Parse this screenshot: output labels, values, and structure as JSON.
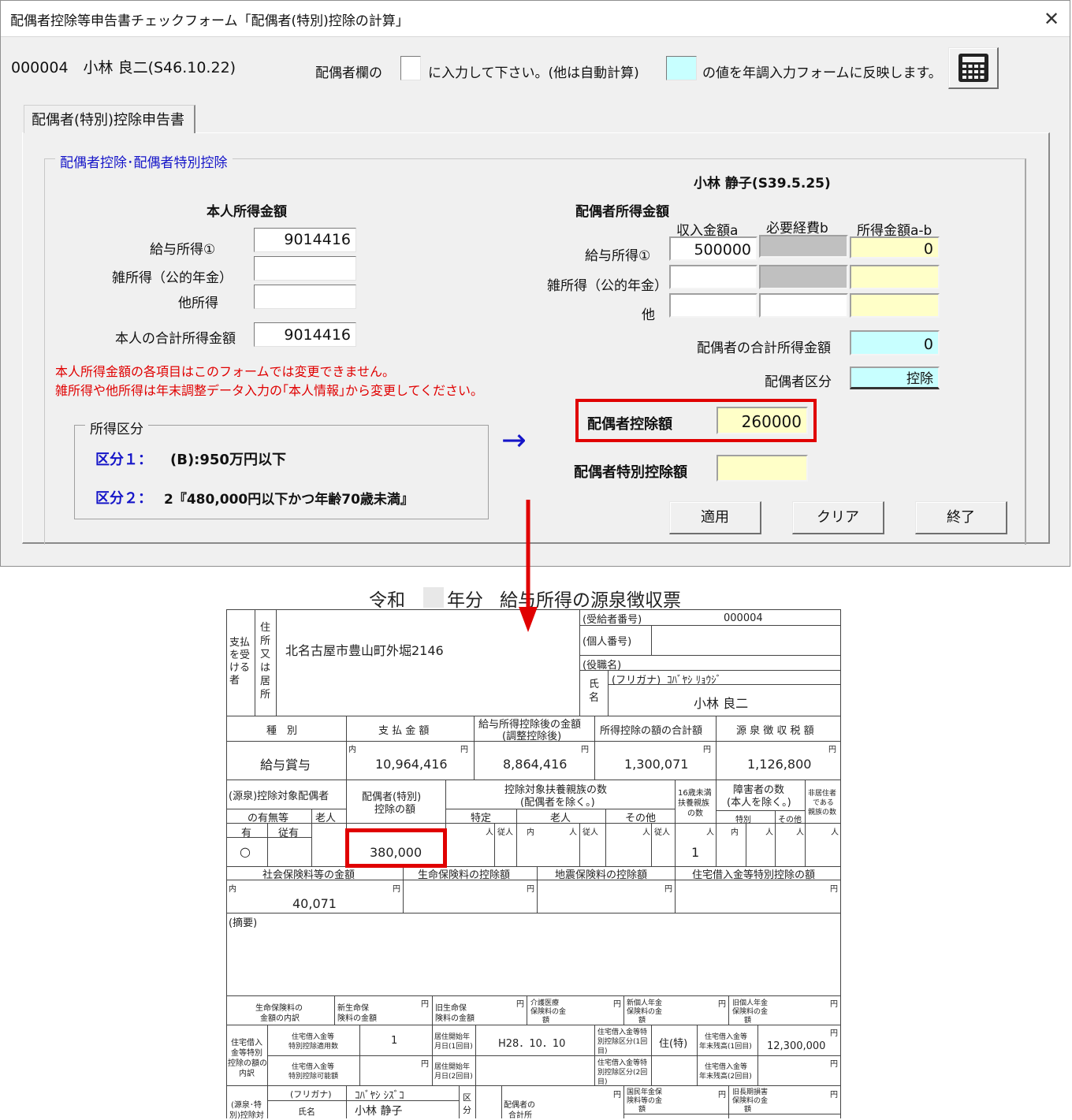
{
  "window": {
    "title": "配偶者控除等申告書チェックフォーム「配偶者(特別)控除の計算」",
    "close_label": "✕"
  },
  "header": {
    "employee": "000004　小林 良二(S46.10.22)",
    "instruction_prefix": "配偶者欄の",
    "instruction_middle": "に入力して下さい。(他は自動計算)",
    "instruction_suffix": "の値を年調入力フォームに反映します。"
  },
  "tab": {
    "label": "配偶者(特別)控除申告書"
  },
  "group": {
    "label": "配偶者控除･配偶者特別控除"
  },
  "self_income": {
    "heading": "本人所得金額",
    "salary_label": "給与所得①",
    "salary_value": "9014416",
    "misc_label": "雑所得（公的年金）",
    "misc_value": "",
    "other_label": "他所得",
    "other_value": "",
    "total_label": "本人の合計所得金額",
    "total_value": "9014416"
  },
  "notice": {
    "line1": "本人所得金額の各項目はこのフォームでは変更できません。",
    "line2": "雑所得や他所得は年末調整データ入力の｢本人情報｣から変更してください。"
  },
  "income_class": {
    "legend": "所得区分",
    "k1_label": "区分１：",
    "k1_value": "(B):950万円以下",
    "k2_label": "区分２：",
    "k2_value": "2『480,000円以下かつ年齢70歳未満』"
  },
  "spouse": {
    "name": "小林 静子(S39.5.25)",
    "heading": "配偶者所得金額",
    "col_a": "収入金額a",
    "col_b": "必要経費b",
    "col_ab": "所得金額a-b",
    "salary_label": "給与所得①",
    "salary_a": "500000",
    "salary_ab": "0",
    "misc_label": "雑所得（公的年金）",
    "other_label": "他",
    "total_label": "配偶者の合計所得金額",
    "total_value": "0",
    "class_label": "配偶者区分",
    "class_value": "控除",
    "deduction_label": "配偶者控除額",
    "deduction_value": "260000",
    "special_label": "配偶者特別控除額",
    "special_value": ""
  },
  "buttons": {
    "apply": "適用",
    "clear": "クリア",
    "end": "終了"
  },
  "arrow_right": "→",
  "colors": {
    "highlight_red": "#e00000",
    "input_yellow": "#ffffc8",
    "input_cyan": "#c8ffff",
    "label_blue": "#1515c8"
  },
  "icons": {
    "calculator": "calculator-icon"
  },
  "form": {
    "title_a": "令和",
    "title_b": "年分",
    "title_c": "給与所得の源泉徴収票",
    "recipient_side": "支払を受ける者",
    "address_label": "住所又は居所",
    "address": "北名古屋市豊山町外堀2146",
    "recipient_no_label": "(受給者番号)",
    "recipient_no": "000004",
    "personal_no_label": "(個人番号)",
    "position_label": "(役職名)",
    "name_label": "氏名",
    "furigana_label": "(フリガナ)",
    "furigana": "ｺﾊﾞﾔｼ ﾘｮｳｼﾞ",
    "name": "小林 良二",
    "h_type": "種　別",
    "h_paid": "支 払 金 額",
    "h_after1": "給与所得控除後の金額",
    "h_after2": "(調整控除後)",
    "h_deduct_total": "所得控除の額の合計額",
    "h_tax": "源 泉 徴 収 税 額",
    "type": "給与賞与",
    "paid": "10,964,416",
    "after": "8,864,416",
    "deduct_total": "1,300,071",
    "tax": "1,126,800",
    "unit_yen": "円",
    "unit_nin": "人",
    "unit_uchi": "内",
    "unit_ju": "従人",
    "spouse_exist1": "(源泉)控除対象配偶者",
    "spouse_exist2": "の有無等",
    "old": "老人",
    "spouse_ded1": "配偶者(特別)",
    "spouse_ded2": "控除の額",
    "dep1": "控除対象扶養親族の数",
    "dep2": "(配偶者を除く。)",
    "dep_special": "特定",
    "dep_old": "老人",
    "dep_other": "その他",
    "under16_1": "16歳未満",
    "under16_2": "扶養親族",
    "under16_3": "の数",
    "disabled1": "障害者の数",
    "disabled2": "(本人を除く。)",
    "disabled_special": "特別",
    "disabled_other": "その他",
    "nonres1": "非居住者",
    "nonres2": "である",
    "nonres3": "親族の数",
    "yes": "有",
    "dependent_yes": "従有",
    "mark": "○",
    "spouse_ded_value": "380,000",
    "under16_value": "1",
    "social_ins": "社会保険料等の金額",
    "life_ins": "生命保険料の控除額",
    "quake_ins": "地震保険料の控除額",
    "housing_loan": "住宅借入金等特別控除の額",
    "social_ins_value": "40,071",
    "summary": "(摘要)",
    "life_breakdown1": "生命保険料の",
    "life_breakdown2": "金額の内訳",
    "new_life1": "新生命保",
    "new_life2": "険料の金額",
    "old_life1": "旧生命保",
    "old_life2": "険料の金額",
    "care1": "介護医療",
    "care2": "保険料の金",
    "care3": "額",
    "new_pension1": "新個人年金",
    "new_pension2": "保険料の金",
    "new_pension3": "額",
    "old_pension1": "旧個人年金",
    "old_pension2": "保険料の金",
    "old_pension3": "額",
    "hl_1": "住宅借入",
    "hl_2": "金等特別",
    "hl_3": "控除の額の",
    "hl_4": "内訳",
    "hl_count1": "住宅借入金等",
    "hl_count2": "特別控除適用数",
    "hl_count_value": "1",
    "hl_date1": "居住開始年",
    "hl_date2": "月日(1回目)",
    "hl_date_value": "H28．10．10",
    "hl_class1": "住宅借入金等特",
    "hl_class2": "別控除区分(1回",
    "hl_class3": "目)",
    "hl_class_value": "住(特)",
    "hl_bal1": "住宅借入金等",
    "hl_bal2": "年末残高(1回目)",
    "hl_bal_value": "12,300,000",
    "hl_possible1": "住宅借入金等",
    "hl_possible2": "特別控除可能額",
    "hl_date21": "居住開始年",
    "hl_date22": "月日(2回目)",
    "hl_class21": "住宅借入金等特",
    "hl_class22": "別控除区分(2回",
    "hl_class23": "目)",
    "hl_bal21": "住宅借入金等",
    "hl_bal22": "年末残高(2回目)",
    "bottom_a1": "(源泉･特",
    "bottom_a2": "別)控除対",
    "bottom_furigana_label": "(フリガナ)",
    "bottom_furigana": "ｺﾊﾞﾔｼ ｼｽﾞｺ",
    "bottom_name_label": "氏名",
    "bottom_name": "小林 静子",
    "bottom_kubun1": "区",
    "bottom_kubun2": "分",
    "bottom_total1": "配偶者の",
    "bottom_total2": "合計所",
    "national_pension1": "国民年金保",
    "national_pension2": "険料等の金",
    "national_pension3": "額",
    "old_long1": "旧長期損害",
    "old_long2": "保険料の金",
    "old_long3": "額"
  }
}
